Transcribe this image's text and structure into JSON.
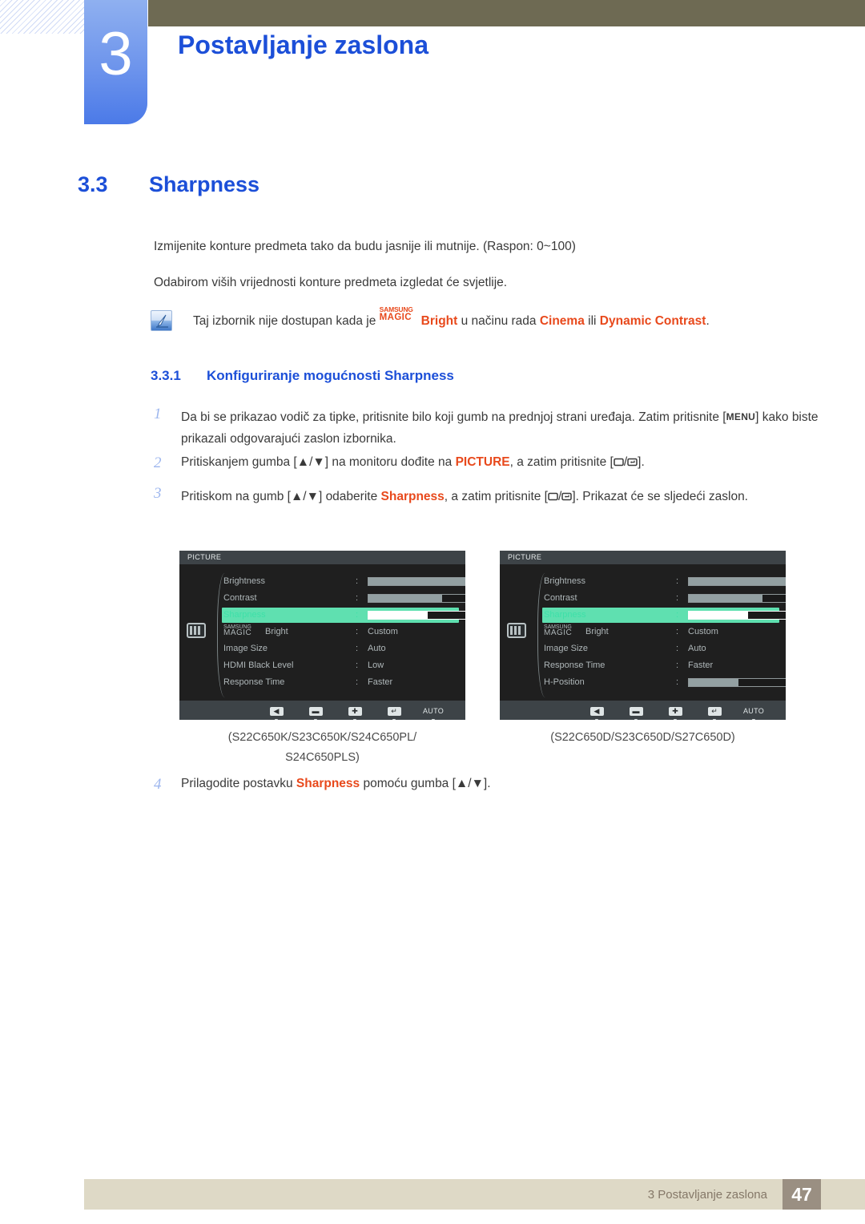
{
  "header": {
    "chapter_number": "3",
    "chapter_title": "Postavljanje zaslona"
  },
  "section": {
    "number": "3.3",
    "title": "Sharpness",
    "paragraph_1": "Izmijenite konture predmeta tako da budu jasnije ili mutnije. (Raspon: 0~100)",
    "paragraph_2": "Odabirom viših vrijednosti konture predmeta izgledat će svjetlije."
  },
  "note": {
    "icon": "note-pencil-icon",
    "text_before": "Taj izbornik nije dostupan kada je ",
    "magic_samsung": "SAMSUNG",
    "magic_magic": "MAGIC",
    "magic_bright": "Bright",
    "text_middle": " u načinu rada ",
    "mode_1": "Cinema",
    "text_ili": " ili ",
    "mode_2": "Dynamic Contrast",
    "text_end": "."
  },
  "subsection": {
    "number": "3.3.1",
    "title": "Konfiguriranje mogućnosti Sharpness"
  },
  "steps": [
    {
      "number": "1",
      "part_a": "Da bi se prikazao vodič za tipke, pritisnite bilo koji gumb na prednjoj strani uređaja. Zatim pritisnite [",
      "key": "MENU",
      "part_b": "] kako biste prikazali odgovarajući zaslon izbornika."
    },
    {
      "number": "2",
      "part_a": "Pritiskanjem gumba [▲/▼] na monitoru dođite na ",
      "highlight": "PICTURE",
      "part_b": ", a zatim pritisnite [",
      "part_c": "/",
      "part_d": "]."
    },
    {
      "number": "3",
      "part_a": "Pritiskom na gumb [▲/▼] odaberite ",
      "highlight": "Sharpness",
      "part_b": ", a zatim pritisnite [",
      "part_c": "/",
      "part_d": "]. Prikazat će se sljedeći zaslon."
    },
    {
      "number": "4",
      "part_a": "Prilagodite postavku ",
      "highlight": "Sharpness",
      "part_b": " pomoću gumba [▲/▼]."
    }
  ],
  "osd_left": {
    "title": "PICTURE",
    "side_icon": "picture-menu-icon",
    "rows": [
      {
        "label": "Brightness",
        "colon": ":",
        "type": "bar",
        "fill": 100,
        "value": "100"
      },
      {
        "label": "Contrast",
        "colon": ":",
        "type": "bar",
        "fill": 75,
        "value": "75"
      },
      {
        "label": "Sharpness",
        "colon": ":",
        "type": "bar",
        "fill": 60,
        "value": "60",
        "selected": true
      },
      {
        "label": "MAGICBright",
        "colon": ":",
        "type": "text",
        "value": "Custom",
        "magic": true
      },
      {
        "label": "Image Size",
        "colon": ":",
        "type": "text",
        "value": "Auto"
      },
      {
        "label": "HDMI Black Level",
        "colon": ":",
        "type": "text",
        "value": "Low"
      },
      {
        "label": "Response Time",
        "colon": ":",
        "type": "text",
        "value": "Faster"
      }
    ],
    "scroll_arrow": "▼",
    "buttons": [
      {
        "name": "left",
        "glyph": "◀",
        "caret": "▼"
      },
      {
        "name": "minus",
        "glyph": "▬",
        "caret": "▼"
      },
      {
        "name": "plus",
        "glyph": "✚",
        "caret": "▼"
      },
      {
        "name": "enter",
        "glyph": "↵",
        "caret": "▼"
      },
      {
        "name": "auto",
        "glyph": "AUTO",
        "caret": "▼",
        "text": true
      },
      {
        "name": "power",
        "glyph": "⏻",
        "caret": "▼",
        "text": true
      }
    ],
    "caption": "(S22C650K/S23C650K/S24C650PL/ S24C650PLS)"
  },
  "osd_right": {
    "title": "PICTURE",
    "side_icon": "picture-menu-icon",
    "rows": [
      {
        "label": "Brightness",
        "colon": ":",
        "type": "bar",
        "fill": 100,
        "value": "100"
      },
      {
        "label": "Contrast",
        "colon": ":",
        "type": "bar",
        "fill": 75,
        "value": "75"
      },
      {
        "label": "Sharpness",
        "colon": ":",
        "type": "bar",
        "fill": 60,
        "value": "60",
        "selected": true
      },
      {
        "label": "MAGICBright",
        "colon": ":",
        "type": "text",
        "value": "Custom",
        "magic": true
      },
      {
        "label": "Image Size",
        "colon": ":",
        "type": "text",
        "value": "Auto"
      },
      {
        "label": "Response Time",
        "colon": ":",
        "type": "text",
        "value": "Faster"
      },
      {
        "label": "H-Position",
        "colon": ":",
        "type": "bar",
        "fill": 50,
        "value": "50"
      }
    ],
    "scroll_arrow": "▼",
    "buttons": [
      {
        "name": "left",
        "glyph": "◀",
        "caret": "▼"
      },
      {
        "name": "minus",
        "glyph": "▬",
        "caret": "▼"
      },
      {
        "name": "plus",
        "glyph": "✚",
        "caret": "▼"
      },
      {
        "name": "enter",
        "glyph": "↵",
        "caret": "▼"
      },
      {
        "name": "auto",
        "glyph": "AUTO",
        "caret": "▼",
        "text": true
      },
      {
        "name": "power",
        "glyph": "⏻",
        "caret": "▼",
        "text": true
      }
    ],
    "caption": "(S22C650D/S23C650D/S27C650D)"
  },
  "captions": {
    "left_line1": "(S22C650K/S23C650K/S24C650PL/",
    "left_line2": "S24C650PLS)",
    "right": "(S22C650D/S23C650D/S27C650D)"
  },
  "footer": {
    "text": "3 Postavljanje zaslona",
    "page": "47"
  },
  "colors": {
    "accent_blue": "#1c4fd8",
    "orange": "#e8491c",
    "olive": "#6e6a53",
    "footer_bar": "#ded9c6",
    "page_box": "#9a8f82",
    "osd_bg": "#1f1f1f",
    "osd_highlight": "#5fe0b0"
  }
}
